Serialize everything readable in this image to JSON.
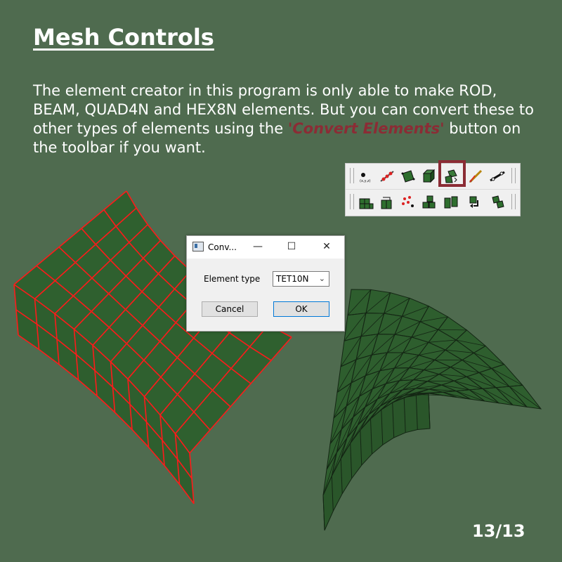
{
  "slide": {
    "title": "Mesh Controls",
    "paragraph_before": "The element creator in this program is only able to make ROD, BEAM, QUAD4N and HEX8N elements. But you can convert these to other types of elements using the ",
    "paragraph_highlight": "'Convert Elements'",
    "paragraph_after": " button on the toolbar if you want.",
    "page_indicator": "13/13",
    "colors": {
      "background": "#4f6b4f",
      "highlight": "#8b2c35",
      "mesh_fill": "#2e5e2e",
      "hex_edges": "#ff1a1a",
      "tet_edges": "#142614"
    }
  },
  "toolbar": {
    "row1_icons": [
      "node-icon",
      "rod-elements-icon",
      "quad-element-icon",
      "hex-element-icon",
      "convert-elements-icon",
      "pen-icon",
      "beam-icon"
    ],
    "row2_icons": [
      "extrude-icon",
      "sweep-icon",
      "scatter-nodes-icon",
      "merge-elements-icon",
      "split-elements-icon",
      "rotate-elements-icon",
      "move-elements-icon"
    ],
    "highlighted": "convert-elements-icon"
  },
  "dialog": {
    "title": "Conv...",
    "minimize": "—",
    "maximize": "☐",
    "close": "✕",
    "element_type_label": "Element type",
    "element_type_value": "TET10N",
    "cancel_label": "Cancel",
    "ok_label": "OK"
  }
}
